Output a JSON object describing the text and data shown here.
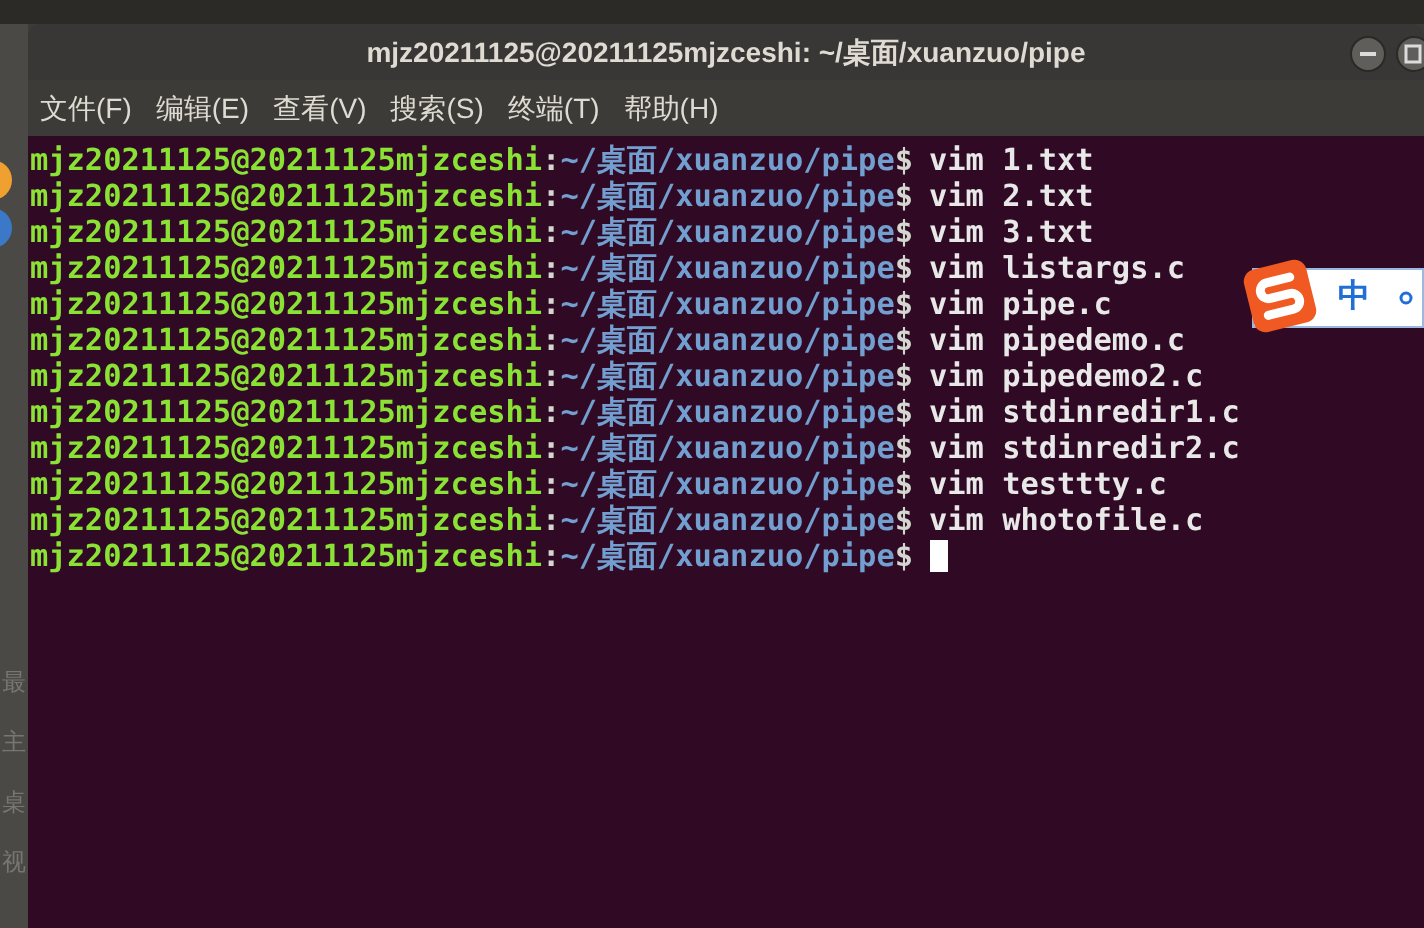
{
  "background_panel": {
    "items": [
      "最",
      "主",
      "桌",
      "视"
    ]
  },
  "window": {
    "title": "mjz20211125@20211125mjzceshi: ~/桌面/xuanzuo/pipe"
  },
  "menu": [
    "文件(F)",
    "编辑(E)",
    "查看(V)",
    "搜索(S)",
    "终端(T)",
    "帮助(H)"
  ],
  "terminal": {
    "lines": [
      {
        "user_host": "mjz20211125@20211125mjzceshi",
        "separator": ":",
        "path": "~/桌面/xuanzuo/pipe",
        "prompt": "$",
        "command": "vim 1.txt"
      },
      {
        "user_host": "mjz20211125@20211125mjzceshi",
        "separator": ":",
        "path": "~/桌面/xuanzuo/pipe",
        "prompt": "$",
        "command": "vim 2.txt"
      },
      {
        "user_host": "mjz20211125@20211125mjzceshi",
        "separator": ":",
        "path": "~/桌面/xuanzuo/pipe",
        "prompt": "$",
        "command": "vim 3.txt"
      },
      {
        "user_host": "mjz20211125@20211125mjzceshi",
        "separator": ":",
        "path": "~/桌面/xuanzuo/pipe",
        "prompt": "$",
        "command": "vim listargs.c"
      },
      {
        "user_host": "mjz20211125@20211125mjzceshi",
        "separator": ":",
        "path": "~/桌面/xuanzuo/pipe",
        "prompt": "$",
        "command": "vim pipe.c"
      },
      {
        "user_host": "mjz20211125@20211125mjzceshi",
        "separator": ":",
        "path": "~/桌面/xuanzuo/pipe",
        "prompt": "$",
        "command": "vim pipedemo.c"
      },
      {
        "user_host": "mjz20211125@20211125mjzceshi",
        "separator": ":",
        "path": "~/桌面/xuanzuo/pipe",
        "prompt": "$",
        "command": "vim pipedemo2.c"
      },
      {
        "user_host": "mjz20211125@20211125mjzceshi",
        "separator": ":",
        "path": "~/桌面/xuanzuo/pipe",
        "prompt": "$",
        "command": "vim stdinredir1.c"
      },
      {
        "user_host": "mjz20211125@20211125mjzceshi",
        "separator": ":",
        "path": "~/桌面/xuanzuo/pipe",
        "prompt": "$",
        "command": "vim stdinredir2.c"
      },
      {
        "user_host": "mjz20211125@20211125mjzceshi",
        "separator": ":",
        "path": "~/桌面/xuanzuo/pipe",
        "prompt": "$",
        "command": "vim testtty.c"
      },
      {
        "user_host": "mjz20211125@20211125mjzceshi",
        "separator": ":",
        "path": "~/桌面/xuanzuo/pipe",
        "prompt": "$",
        "command": "vim whotofile.c"
      },
      {
        "user_host": "mjz20211125@20211125mjzceshi",
        "separator": ":",
        "path": "~/桌面/xuanzuo/pipe",
        "prompt": "$",
        "cursor": true
      }
    ]
  },
  "ime_toolbar": {
    "mode": "中"
  }
}
